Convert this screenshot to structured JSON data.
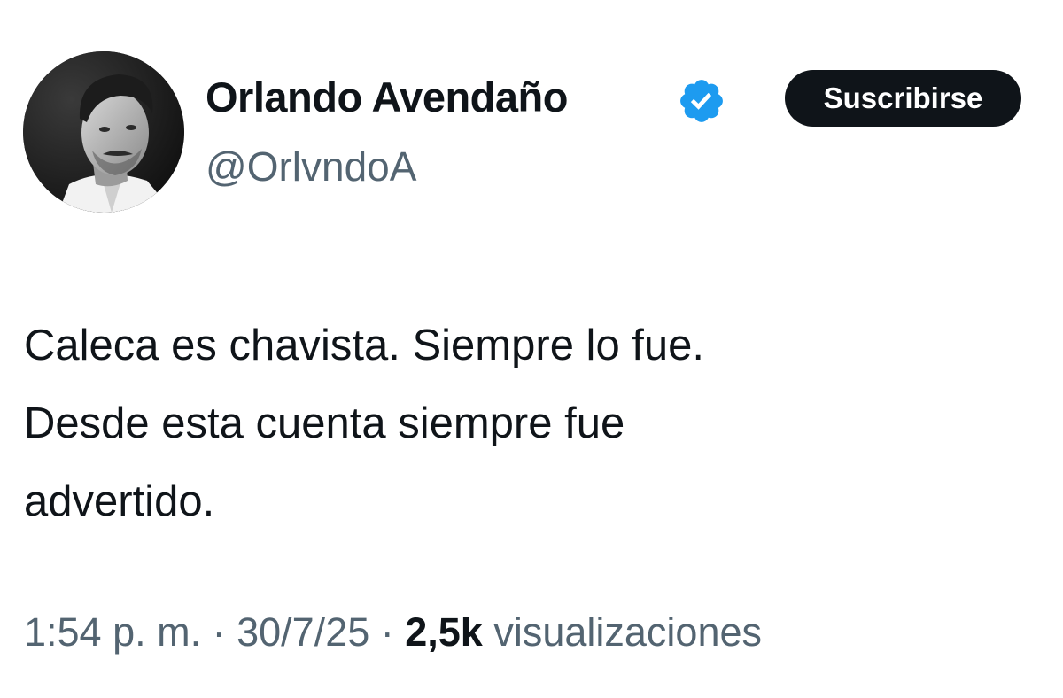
{
  "author": {
    "name": "Orlando Avendaño",
    "handle": "@OrlvndoA",
    "verified": true,
    "avatar_icon": "profile-photo",
    "verified_color": "#1d9bf0"
  },
  "actions": {
    "subscribe_label": "Suscribirse"
  },
  "tweet": {
    "lines": [
      "Caleca es chavista. Siempre lo fue.",
      "Desde esta cuenta siempre fue",
      "advertido."
    ]
  },
  "meta": {
    "time": "1:54 p. m.",
    "separator": " · ",
    "date": "30/7/25",
    "views_count": "2,5k",
    "views_label": "visualizaciones"
  },
  "colors": {
    "text": "#0f1419",
    "secondary": "#536471",
    "button_bg": "#0f1419",
    "button_text": "#ffffff",
    "verified": "#1d9bf0"
  }
}
